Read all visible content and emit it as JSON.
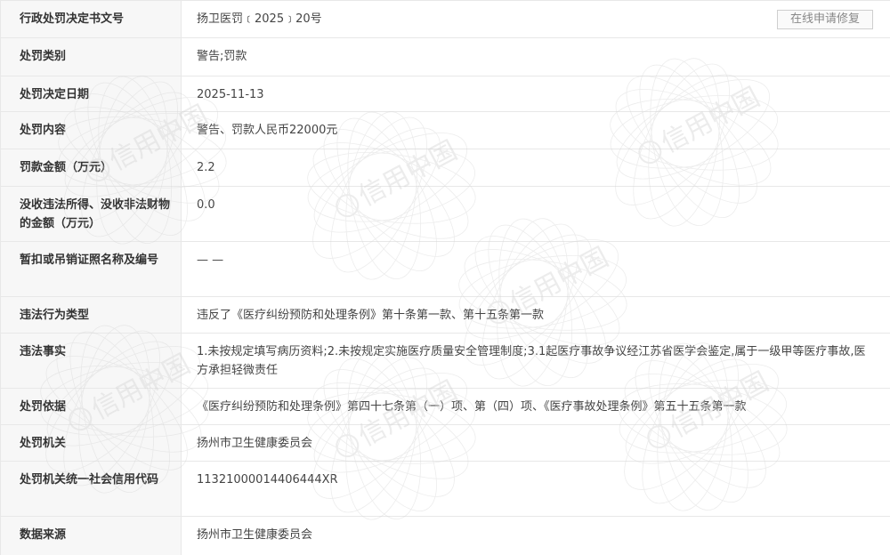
{
  "repair_button": "在线申请修复",
  "rows": [
    {
      "label": "行政处罚决定书文号",
      "value": "扬卫医罚﹝2025﹞20号"
    },
    {
      "label": "处罚类别",
      "value": "警告;罚款"
    },
    {
      "label": "处罚决定日期",
      "value": "2025-11-13"
    },
    {
      "label": "处罚内容",
      "value": "警告、罚款人民币22000元"
    },
    {
      "label": "罚款金额（万元）",
      "value": "2.2"
    },
    {
      "label": "没收违法所得、没收非法财物的金额（万元）",
      "value": "0.0"
    },
    {
      "label": "暂扣或吊销证照名称及编号",
      "value": "— —"
    },
    {
      "label": "违法行为类型",
      "value": "违反了《医疗纠纷预防和处理条例》第十条第一款、第十五条第一款"
    },
    {
      "label": "违法事实",
      "value": "1.未按规定填写病历资料;2.未按规定实施医疗质量安全管理制度;3.1起医疗事故争议经江苏省医学会鉴定,属于一级甲等医疗事故,医方承担轻微责任"
    },
    {
      "label": "处罚依据",
      "value": "《医疗纠纷预防和处理条例》第四十七条第（一）项、第（四）项、《医疗事故处理条例》第五十五条第一款"
    },
    {
      "label": "处罚机关",
      "value": "扬州市卫生健康委员会"
    },
    {
      "label": "处罚机关统一社会信用代码",
      "value": "11321000014406444XR"
    },
    {
      "label": "数据来源",
      "value": "扬州市卫生健康委员会"
    }
  ],
  "watermark": {
    "text": "信用中国",
    "color": "#d6d6d6"
  }
}
